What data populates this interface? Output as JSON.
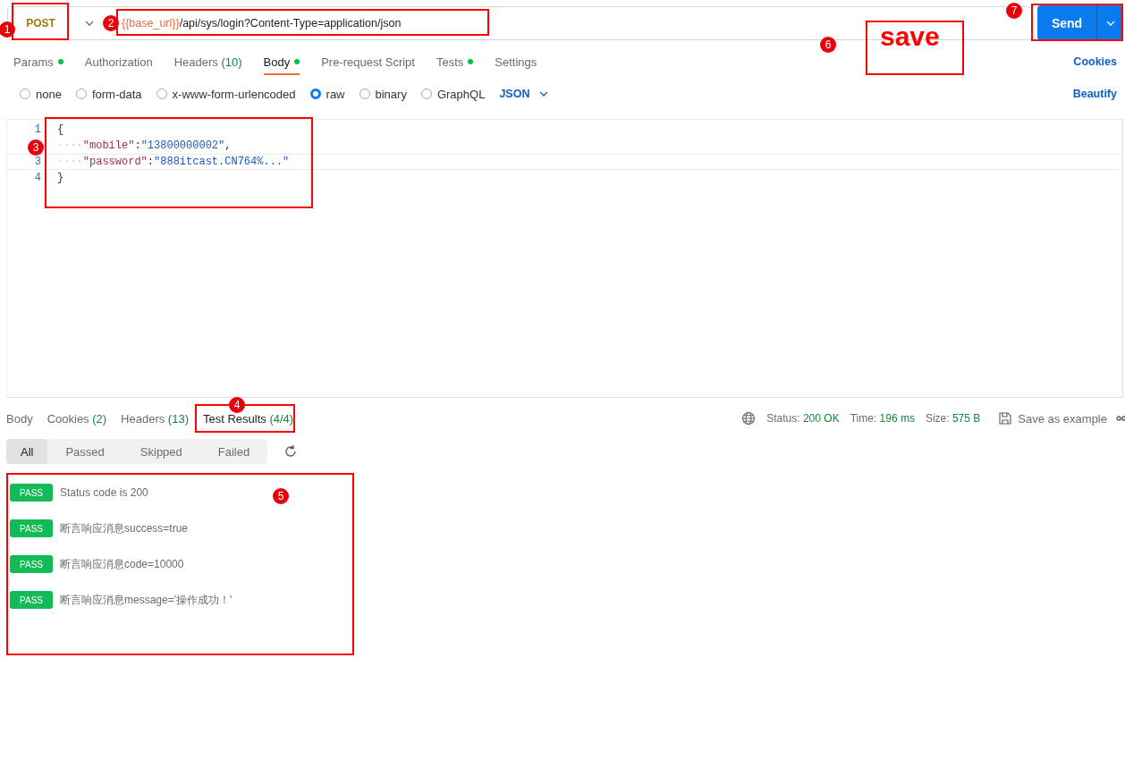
{
  "request": {
    "method": "POST",
    "url_variable": "{{base_url}}",
    "url_path": "/api/sys/login?Content-Type=application/json",
    "send_label": "Send"
  },
  "request_tabs": [
    {
      "label": "Params",
      "dot": true,
      "selected": false
    },
    {
      "label": "Authorization",
      "dot": false,
      "selected": false
    },
    {
      "label": "Headers",
      "count": "(10)",
      "dot": false,
      "selected": false
    },
    {
      "label": "Body",
      "dot": true,
      "selected": true
    },
    {
      "label": "Pre-request Script",
      "dot": false,
      "selected": false
    },
    {
      "label": "Tests",
      "dot": true,
      "selected": false
    },
    {
      "label": "Settings",
      "dot": false,
      "selected": false
    }
  ],
  "cookies_link": "Cookies",
  "body_types": [
    {
      "label": "none",
      "selected": false
    },
    {
      "label": "form-data",
      "selected": false
    },
    {
      "label": "x-www-form-urlencoded",
      "selected": false
    },
    {
      "label": "raw",
      "selected": true
    },
    {
      "label": "binary",
      "selected": false
    },
    {
      "label": "GraphQL",
      "selected": false
    }
  ],
  "body_format": "JSON",
  "beautify": "Beautify",
  "editor": {
    "lines": [
      {
        "number": "1",
        "tokens": [
          {
            "kind": "punct",
            "text": "{"
          }
        ]
      },
      {
        "tokens": [
          {
            "kind": "indent",
            "text": "····"
          },
          {
            "kind": "key",
            "text": "\"mobile\""
          },
          {
            "kind": "punct",
            "text": ":"
          },
          {
            "kind": "string",
            "text": "\"13800000002\""
          },
          {
            "kind": "punct",
            "text": ","
          }
        ]
      },
      {
        "number": "3",
        "tokens": [
          {
            "kind": "indent",
            "text": "····"
          },
          {
            "kind": "key",
            "text": "\"password\""
          },
          {
            "kind": "punct",
            "text": ":"
          },
          {
            "kind": "string",
            "text": "\"888itcast.CN764%...\""
          }
        ]
      },
      {
        "number": "4",
        "tokens": [
          {
            "kind": "punct",
            "text": "}"
          }
        ]
      }
    ]
  },
  "response_tabs": [
    {
      "label": "Body",
      "selected": false
    },
    {
      "label": "Cookies",
      "count": "(2)",
      "selected": false
    },
    {
      "label": "Headers",
      "count": "(13)",
      "selected": false
    },
    {
      "label": "Test Results",
      "count": "(4/4)",
      "selected": true
    }
  ],
  "response_meta": [
    {
      "label": "Status:",
      "value": "200 OK"
    },
    {
      "label": "Time:",
      "value": "196 ms"
    },
    {
      "label": "Size:",
      "value": "575 B"
    }
  ],
  "save_example": "Save as example",
  "filters": [
    {
      "label": "All",
      "selected": true
    },
    {
      "label": "Passed",
      "selected": false
    },
    {
      "label": "Skipped",
      "selected": false
    },
    {
      "label": "Failed",
      "selected": false
    }
  ],
  "results": [
    {
      "status": "PASS",
      "name": "Status code is 200"
    },
    {
      "status": "PASS",
      "name": "断言响应消息success=true"
    },
    {
      "status": "PASS",
      "name": "断言响应消息code=10000"
    },
    {
      "status": "PASS",
      "name": "断言响应消息message='操作成功！'"
    }
  ],
  "annotations": {
    "markers": [
      "1",
      "2",
      "3",
      "4",
      "5",
      "6",
      "7"
    ],
    "note": "save"
  }
}
